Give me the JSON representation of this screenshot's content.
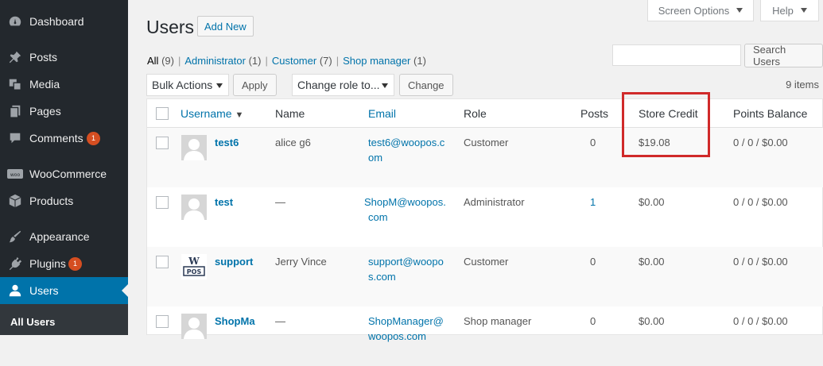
{
  "sidebar": {
    "items": [
      {
        "label": "Dashboard",
        "icon": "dashboard-icon"
      },
      {
        "label": "Posts",
        "icon": "pin-icon"
      },
      {
        "label": "Media",
        "icon": "media-icon"
      },
      {
        "label": "Pages",
        "icon": "pages-icon"
      },
      {
        "label": "Comments",
        "icon": "comment-icon",
        "badge": "1"
      },
      {
        "label": "WooCommerce",
        "icon": "woocommerce-icon"
      },
      {
        "label": "Products",
        "icon": "box-icon"
      },
      {
        "label": "Appearance",
        "icon": "brush-icon"
      },
      {
        "label": "Plugins",
        "icon": "plugin-icon",
        "badge": "1"
      },
      {
        "label": "Users",
        "icon": "user-icon"
      }
    ],
    "submenu": {
      "label": "All Users"
    }
  },
  "header": {
    "title": "Users",
    "add_new": "Add New",
    "screen_options": "Screen Options",
    "help": "Help"
  },
  "filters": {
    "all": {
      "label": "All",
      "count": "(9)"
    },
    "administrator": {
      "label": "Administrator",
      "count": "(1)"
    },
    "customer": {
      "label": "Customer",
      "count": "(7)"
    },
    "shop_manager": {
      "label": "Shop manager",
      "count": "(1)"
    }
  },
  "search": {
    "button": "Search Users",
    "value": ""
  },
  "bulk": {
    "selected": "Bulk Actions",
    "apply": "Apply"
  },
  "role_change": {
    "selected": "Change role to...",
    "button": "Change"
  },
  "items_count": "9 items",
  "columns": {
    "username": "Username",
    "name": "Name",
    "email": "Email",
    "role": "Role",
    "posts": "Posts",
    "store_credit": "Store Credit",
    "points_balance": "Points Balance"
  },
  "rows": [
    {
      "username": "test6",
      "name": "alice g6",
      "email1": "test6@woopos.c",
      "email2": "om",
      "role": "Customer",
      "posts": "0",
      "credit": "$19.08",
      "points": "0 / 0 / $0.00"
    },
    {
      "username": "test",
      "name": "—",
      "email1": "ShopM@woopos.",
      "email2": "com",
      "role": "Administrator",
      "posts": "1",
      "credit": "$0.00",
      "points": "0 / 0 / $0.00"
    },
    {
      "username": "support",
      "name": "Jerry Vince",
      "email1": "support@woopo",
      "email2": "s.com",
      "role": "Customer",
      "posts": "0",
      "credit": "$0.00",
      "points": "0 / 0 / $0.00"
    },
    {
      "username": "ShopMa",
      "name": "—",
      "email1": "ShopManager@",
      "email2": "woopos.com",
      "role": "Shop manager",
      "posts": "0",
      "credit": "$0.00",
      "points": "0 / 0 / $0.00"
    }
  ],
  "colors": {
    "sidebar": "#23282d",
    "active": "#0073aa",
    "link": "#0073aa",
    "badge": "#d54e21",
    "highlight": "#d02a2a"
  }
}
